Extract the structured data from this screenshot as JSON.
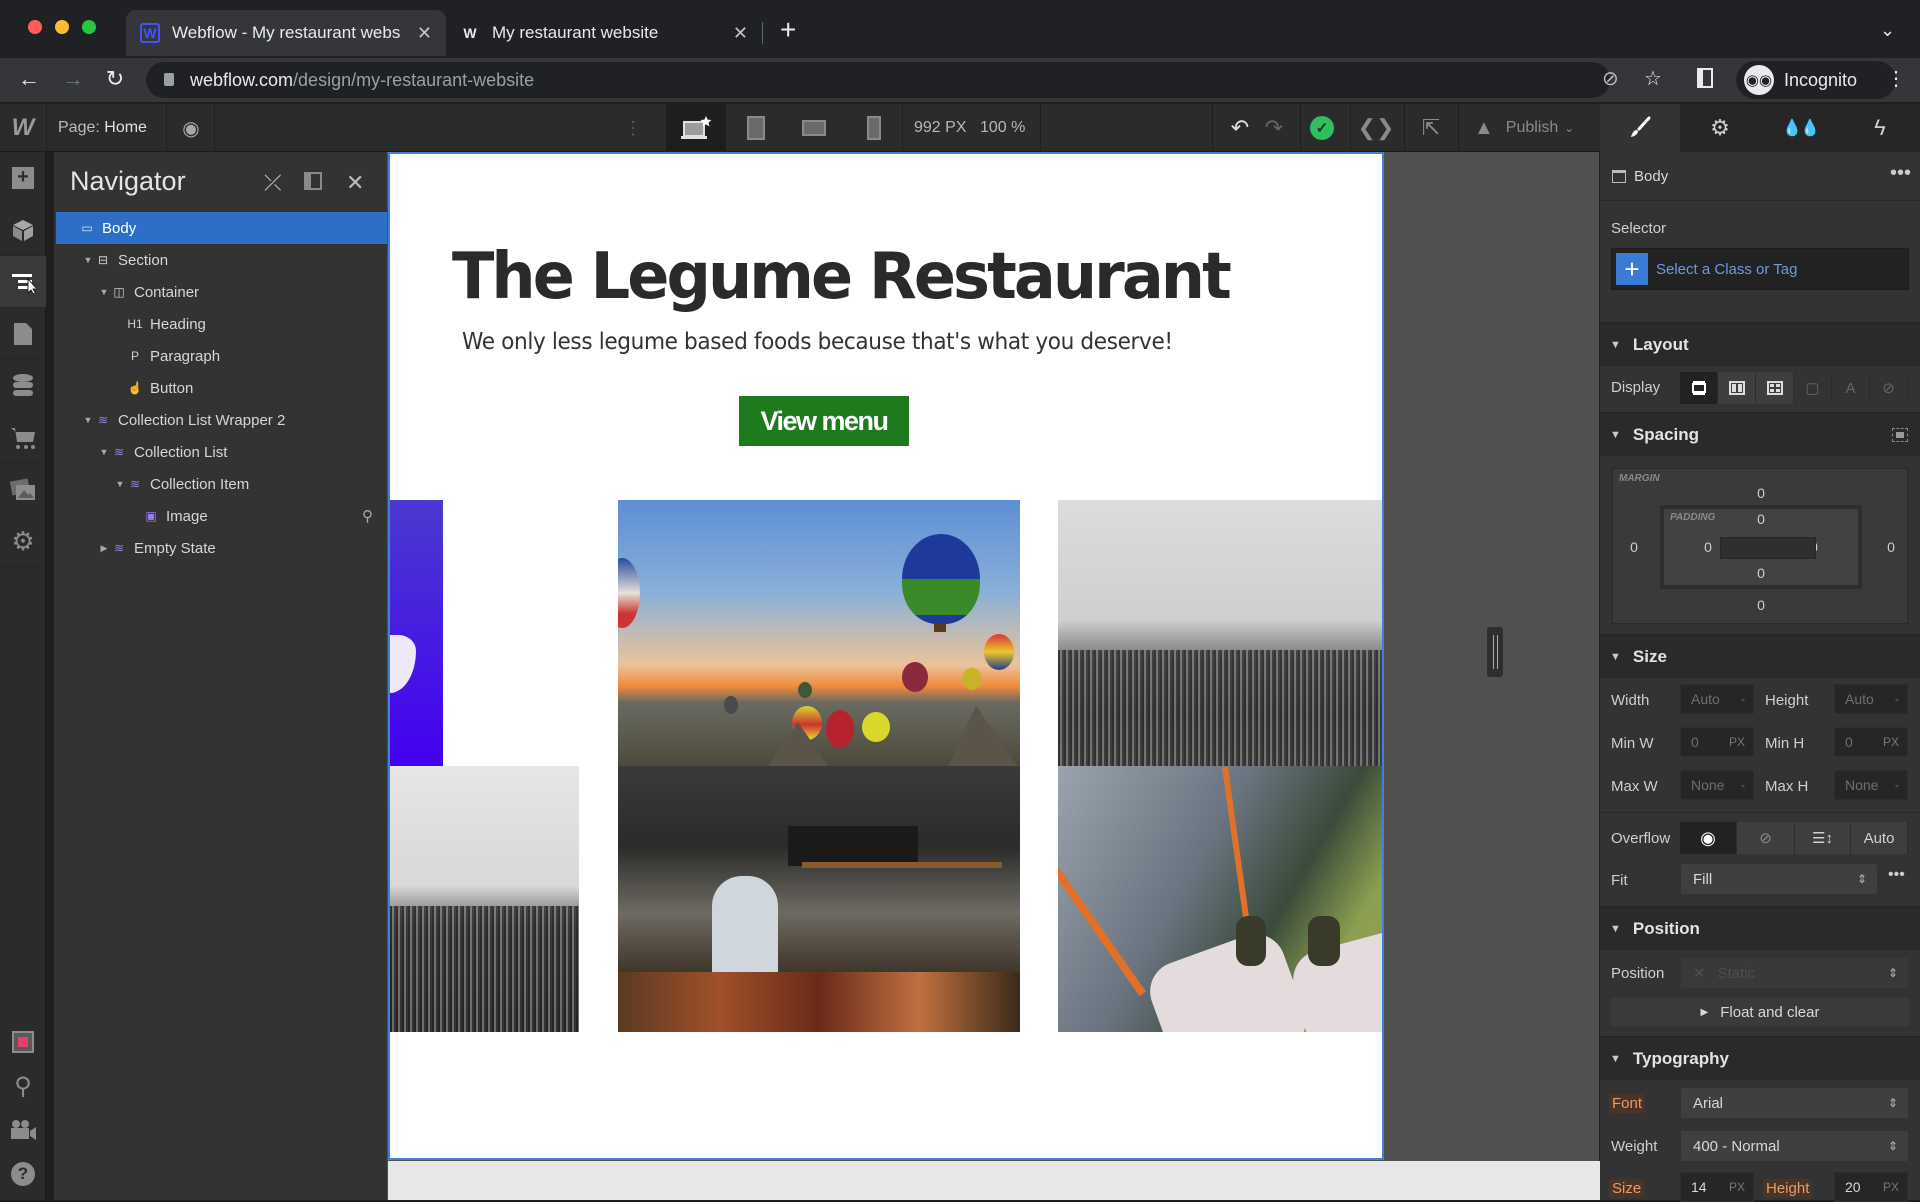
{
  "browser": {
    "tabs": [
      {
        "title": "Webflow - My restaurant webs",
        "favicon": "W",
        "active": true
      },
      {
        "title": "My restaurant website",
        "favicon": "W",
        "active": false
      }
    ],
    "new_tab_label": "+",
    "url_host": "webflow.com",
    "url_path": "/design/my-restaurant-website",
    "profile_label": "Incognito",
    "tab_list_icon": "chevron-down-icon"
  },
  "designer_toolbar": {
    "logo": "W",
    "page_label": "Page:",
    "page_name": "Home",
    "viewport_width": "992 PX",
    "zoom": "100 %",
    "publish_label": "Publish",
    "status": "saved",
    "status_color": "#2fbf5e"
  },
  "left_rail": {
    "items": [
      {
        "name": "add-panel",
        "icon": "plus-icon"
      },
      {
        "name": "symbols",
        "icon": "cube-icon"
      },
      {
        "name": "navigator",
        "icon": "navigator-icon",
        "active": true
      },
      {
        "name": "pages",
        "icon": "page-icon"
      },
      {
        "name": "cms",
        "icon": "database-icon"
      },
      {
        "name": "ecommerce",
        "icon": "cart-icon"
      },
      {
        "name": "assets",
        "icon": "images-icon"
      },
      {
        "name": "settings",
        "icon": "gear-icon"
      }
    ],
    "bottom_items": [
      {
        "name": "audit",
        "icon": "record-icon"
      },
      {
        "name": "search",
        "icon": "search-icon"
      },
      {
        "name": "video-tutorials",
        "icon": "video-camera-icon"
      },
      {
        "name": "help",
        "icon": "help-icon"
      }
    ]
  },
  "navigator": {
    "title": "Navigator",
    "tree": [
      {
        "label": "Body",
        "type": "body",
        "depth": 0,
        "selected": true,
        "caret": ""
      },
      {
        "label": "Section",
        "type": "section",
        "depth": 1,
        "caret": "open"
      },
      {
        "label": "Container",
        "type": "container",
        "depth": 2,
        "caret": "open"
      },
      {
        "label": "Heading",
        "type": "h1",
        "depth": 3,
        "caret": ""
      },
      {
        "label": "Paragraph",
        "type": "p",
        "depth": 3,
        "caret": ""
      },
      {
        "label": "Button",
        "type": "button",
        "depth": 3,
        "caret": ""
      },
      {
        "label": "Collection List Wrapper 2",
        "type": "cms",
        "depth": 1,
        "caret": "open"
      },
      {
        "label": "Collection List",
        "type": "cms-list",
        "depth": 2,
        "caret": "open"
      },
      {
        "label": "Collection Item",
        "type": "cms-item",
        "depth": 3,
        "caret": "open"
      },
      {
        "label": "Image",
        "type": "image",
        "depth": 4,
        "caret": ""
      },
      {
        "label": "Empty State",
        "type": "cms-empty",
        "depth": 2,
        "caret": "closed"
      }
    ]
  },
  "canvas": {
    "heading": "The Legume Restaurant",
    "paragraph": "We only less legume based foods because that's what you deserve!",
    "button_label": "View menu",
    "button_color": "#1d7a1d",
    "images": [
      {
        "subject": "purple gradient graphic"
      },
      {
        "subject": "hot air balloons at sunset"
      },
      {
        "subject": "black and white birds over grass"
      },
      {
        "subject": "black and white birds over grass"
      },
      {
        "subject": "cafe kitchen with chef"
      },
      {
        "subject": "feet dangling above city buildings"
      }
    ]
  },
  "style_panel": {
    "tabs": [
      "style-brush",
      "settings-gear",
      "interactions-drops",
      "lightning"
    ],
    "element": "Body",
    "selector_label": "Selector",
    "selector_placeholder": "Select a Class or Tag",
    "layout": {
      "title": "Layout",
      "display_label": "Display",
      "display_selected": "block"
    },
    "spacing": {
      "title": "Spacing",
      "margin_label": "MARGIN",
      "padding_label": "PADDING",
      "margin": {
        "top": "0",
        "right": "0",
        "bottom": "0",
        "left": "0"
      },
      "padding": {
        "top": "0",
        "right": "0",
        "bottom": "0",
        "left": "0"
      }
    },
    "size": {
      "title": "Size",
      "width_label": "Width",
      "width": "Auto",
      "width_unit": "-",
      "height_label": "Height",
      "height": "Auto",
      "height_unit": "-",
      "min_w_label": "Min W",
      "min_w": "0",
      "min_w_unit": "PX",
      "min_h_label": "Min H",
      "min_h": "0",
      "min_h_unit": "PX",
      "max_w_label": "Max W",
      "max_w": "None",
      "max_w_unit": "-",
      "max_h_label": "Max H",
      "max_h": "None",
      "max_h_unit": "-",
      "overflow_label": "Overflow",
      "overflow_auto": "Auto",
      "fit_label": "Fit",
      "fit": "Fill"
    },
    "position": {
      "title": "Position",
      "position_label": "Position",
      "position_value": "Static",
      "float_clear": "Float and clear"
    },
    "typography": {
      "title": "Typography",
      "font_label": "Font",
      "font": "Arial",
      "weight_label": "Weight",
      "weight": "400 - Normal",
      "size_label": "Size",
      "size": "14",
      "size_unit": "PX",
      "line_height_label": "Height",
      "line_height": "20",
      "line_height_unit": "PX"
    }
  }
}
